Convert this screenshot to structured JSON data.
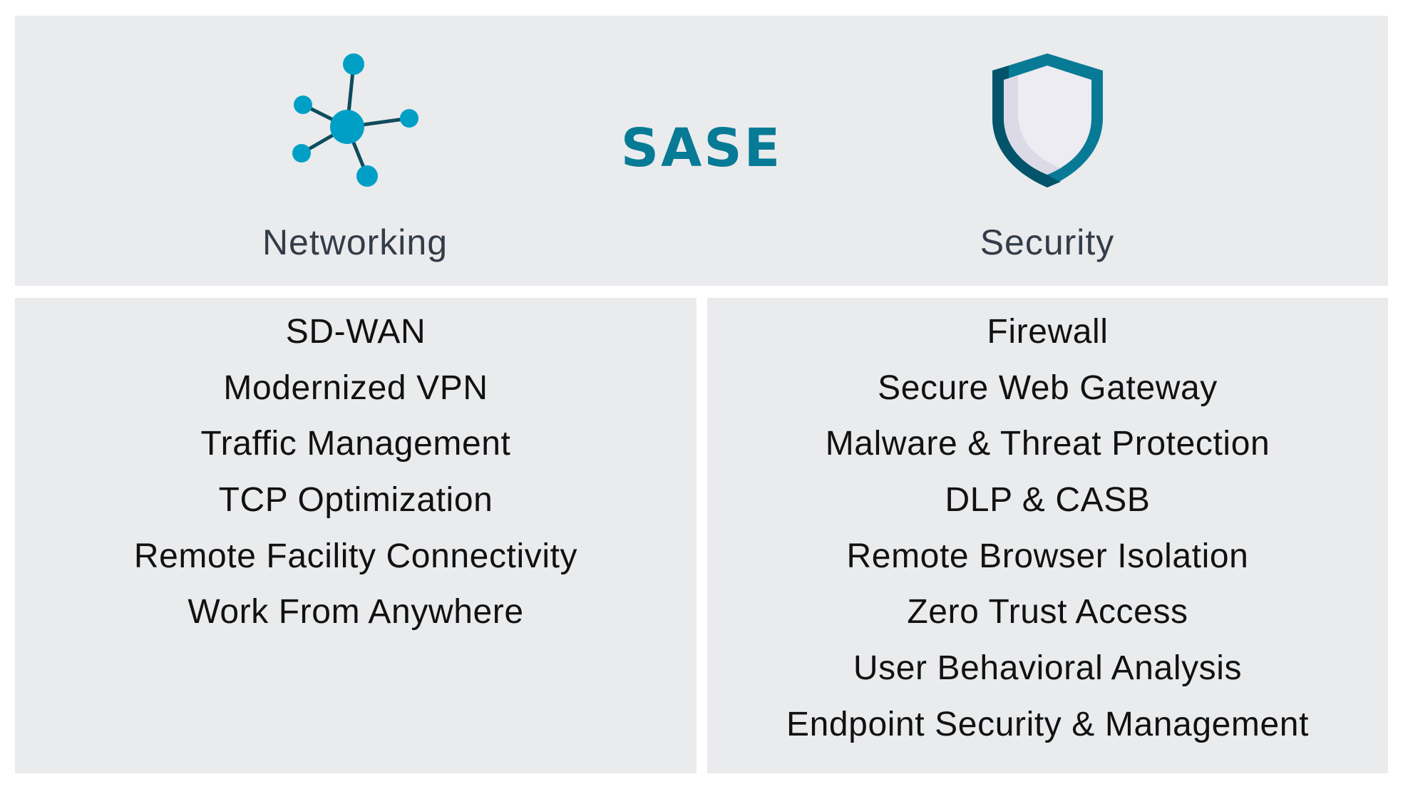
{
  "header": {
    "title": "SASE",
    "colors": {
      "brand": "#077A96",
      "node": "#00A0C6",
      "link": "#0F4C5C",
      "shield_dark": "#03546A",
      "shield_outer": "#087A96",
      "shield_inner": "#ECECF2",
      "shield_inner_shade": "#DCDAE6",
      "panel_bg": "#EAEBED",
      "label_text": "#333C48",
      "item_text": "#111111"
    }
  },
  "pillars": {
    "networking": {
      "icon": "network-nodes-icon",
      "label": "Networking",
      "items": [
        "SD-WAN",
        "Modernized VPN",
        "Traffic Management",
        "TCP Optimization",
        "Remote Facility Connectivity",
        "Work From Anywhere"
      ]
    },
    "security": {
      "icon": "shield-icon",
      "label": "Security",
      "items": [
        "Firewall",
        "Secure Web Gateway",
        "Malware & Threat Protection",
        "DLP & CASB",
        "Remote Browser Isolation",
        "Zero Trust Access",
        "User Behavioral Analysis",
        "Endpoint Security & Management"
      ]
    }
  }
}
